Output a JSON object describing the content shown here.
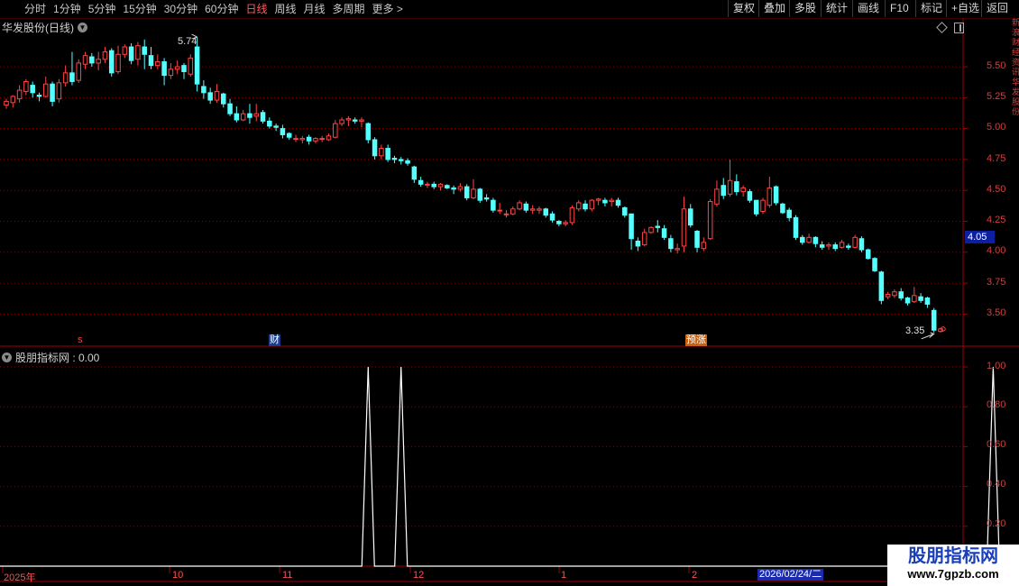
{
  "toolbar": {
    "periods": [
      "分时",
      "1分钟",
      "5分钟",
      "15分钟",
      "30分钟",
      "60分钟",
      "日线",
      "周线",
      "月线",
      "多周期",
      "更多"
    ],
    "active_period": "日线",
    "more_arrow": ">",
    "buttons": [
      "复权",
      "叠加",
      "多股",
      "统计",
      "画线",
      "F10",
      "标记",
      "+自选",
      "返回"
    ]
  },
  "main_chart": {
    "title": "华发股份(日线)",
    "high_label": "5.74",
    "low_label": "3.35",
    "current_price": "4.05",
    "price_axis": [
      "5.50",
      "5.25",
      "5.00",
      "4.75",
      "4.50",
      "4.25",
      "4.00",
      "3.75",
      "3.50"
    ],
    "events": [
      {
        "label": "s",
        "type": "s"
      },
      {
        "label": "财",
        "type": "cai"
      },
      {
        "label": "预涨",
        "type": "yu"
      }
    ],
    "colors": {
      "up": "#ff4444",
      "down": "#54ffff",
      "grid": "#8b0000",
      "border": "#a00000"
    }
  },
  "indicator": {
    "title": "股朋指标网 : 0.00",
    "axis": [
      "1.00",
      "0.80",
      "0.60",
      "0.40",
      "0.20"
    ]
  },
  "date_axis": {
    "labels": [
      "2025年",
      "10",
      "11",
      "12",
      "1",
      "2"
    ],
    "selected_date": "2026/02/24/二"
  },
  "watermark": {
    "line1": "股朋指标网",
    "line2": "www.7gpzb.com"
  },
  "right_strip_text": "新浪财经资讯华发股份",
  "chart_data": {
    "type": "candlestick",
    "ylim": [
      3.3,
      5.85
    ],
    "candles": [
      [
        5.19,
        5.22,
        5.16,
        5.24
      ],
      [
        5.21,
        5.26,
        5.17,
        5.27
      ],
      [
        5.24,
        5.31,
        5.21,
        5.35
      ],
      [
        5.3,
        5.38,
        5.27,
        5.4
      ],
      [
        5.35,
        5.29,
        5.25,
        5.38
      ],
      [
        5.27,
        5.26,
        5.22,
        5.29
      ],
      [
        5.26,
        5.36,
        5.25,
        5.42
      ],
      [
        5.36,
        5.22,
        5.18,
        5.38
      ],
      [
        5.24,
        5.37,
        5.21,
        5.4
      ],
      [
        5.37,
        5.45,
        5.34,
        5.51
      ],
      [
        5.45,
        5.38,
        5.35,
        5.62
      ],
      [
        5.39,
        5.53,
        5.37,
        5.56
      ],
      [
        5.52,
        5.59,
        5.48,
        5.62
      ],
      [
        5.58,
        5.53,
        5.5,
        5.61
      ],
      [
        5.53,
        5.56,
        5.47,
        5.62
      ],
      [
        5.56,
        5.62,
        5.53,
        5.66
      ],
      [
        5.63,
        5.45,
        5.42,
        5.65
      ],
      [
        5.46,
        5.6,
        5.44,
        5.67
      ],
      [
        5.6,
        5.66,
        5.57,
        5.68
      ],
      [
        5.66,
        5.55,
        5.52,
        5.69
      ],
      [
        5.56,
        5.67,
        5.51,
        5.7
      ],
      [
        5.66,
        5.6,
        5.48,
        5.72
      ],
      [
        5.59,
        5.51,
        5.48,
        5.66
      ],
      [
        5.51,
        5.54,
        5.48,
        5.6
      ],
      [
        5.54,
        5.43,
        5.35,
        5.57
      ],
      [
        5.43,
        5.48,
        5.4,
        5.53
      ],
      [
        5.48,
        5.5,
        5.44,
        5.55
      ],
      [
        5.51,
        5.46,
        5.4,
        5.53
      ],
      [
        5.44,
        5.57,
        5.42,
        5.6
      ],
      [
        5.66,
        5.36,
        5.3,
        5.74
      ],
      [
        5.34,
        5.29,
        5.24,
        5.39
      ],
      [
        5.29,
        5.23,
        5.2,
        5.33
      ],
      [
        5.23,
        5.3,
        5.21,
        5.36
      ],
      [
        5.28,
        5.2,
        5.17,
        5.29
      ],
      [
        5.2,
        5.12,
        5.1,
        5.24
      ],
      [
        5.12,
        5.07,
        5.05,
        5.18
      ],
      [
        5.07,
        5.12,
        5.06,
        5.15
      ],
      [
        5.12,
        5.09,
        5.04,
        5.2
      ],
      [
        5.1,
        5.12,
        5.06,
        5.2
      ],
      [
        5.13,
        5.06,
        5.04,
        5.15
      ],
      [
        5.06,
        5.02,
        5.0,
        5.09
      ],
      [
        5.02,
        5.01,
        4.98,
        5.04
      ],
      [
        5.0,
        4.95,
        4.92,
        5.03
      ],
      [
        4.96,
        4.93,
        4.91,
        4.97
      ],
      [
        4.92,
        4.92,
        4.89,
        4.95
      ],
      [
        4.91,
        4.92,
        4.88,
        4.94
      ],
      [
        4.93,
        4.9,
        4.87,
        4.95
      ],
      [
        4.9,
        4.92,
        4.88,
        4.93
      ],
      [
        4.92,
        4.92,
        4.89,
        4.94
      ],
      [
        4.91,
        4.94,
        4.9,
        4.96
      ],
      [
        4.93,
        5.04,
        4.92,
        5.07
      ],
      [
        5.04,
        5.07,
        5.02,
        5.09
      ],
      [
        5.07,
        5.08,
        5.02,
        5.1
      ],
      [
        5.07,
        5.06,
        5.04,
        5.09
      ],
      [
        5.06,
        5.07,
        5.01,
        5.09
      ],
      [
        5.04,
        4.91,
        4.88,
        5.05
      ],
      [
        4.91,
        4.78,
        4.75,
        4.93
      ],
      [
        4.78,
        4.84,
        4.75,
        4.87
      ],
      [
        4.84,
        4.75,
        4.73,
        4.87
      ],
      [
        4.76,
        4.75,
        4.72,
        4.78
      ],
      [
        4.75,
        4.74,
        4.71,
        4.77
      ],
      [
        4.74,
        4.72,
        4.7,
        4.76
      ],
      [
        4.69,
        4.59,
        4.56,
        4.7
      ],
      [
        4.58,
        4.55,
        4.53,
        4.61
      ],
      [
        4.55,
        4.55,
        4.52,
        4.57
      ],
      [
        4.55,
        4.53,
        4.51,
        4.57
      ],
      [
        4.53,
        4.55,
        4.5,
        4.56
      ],
      [
        4.54,
        4.52,
        4.51,
        4.55
      ],
      [
        4.52,
        4.51,
        4.47,
        4.54
      ],
      [
        4.51,
        4.53,
        4.49,
        4.56
      ],
      [
        4.53,
        4.44,
        4.42,
        4.55
      ],
      [
        4.44,
        4.51,
        4.43,
        4.59
      ],
      [
        4.51,
        4.42,
        4.4,
        4.52
      ],
      [
        4.44,
        4.43,
        4.41,
        4.47
      ],
      [
        4.42,
        4.34,
        4.32,
        4.44
      ],
      [
        4.34,
        4.34,
        4.31,
        4.4
      ],
      [
        4.31,
        4.31,
        4.28,
        4.34
      ],
      [
        4.31,
        4.35,
        4.3,
        4.37
      ],
      [
        4.35,
        4.4,
        4.34,
        4.42
      ],
      [
        4.39,
        4.34,
        4.32,
        4.41
      ],
      [
        4.34,
        4.35,
        4.31,
        4.38
      ],
      [
        4.34,
        4.35,
        4.31,
        4.37
      ],
      [
        4.35,
        4.3,
        4.28,
        4.36
      ],
      [
        4.31,
        4.26,
        4.24,
        4.33
      ],
      [
        4.25,
        4.23,
        4.21,
        4.26
      ],
      [
        4.23,
        4.24,
        4.21,
        4.26
      ],
      [
        4.24,
        4.36,
        4.22,
        4.38
      ],
      [
        4.35,
        4.4,
        4.33,
        4.42
      ],
      [
        4.39,
        4.35,
        4.33,
        4.42
      ],
      [
        4.35,
        4.42,
        4.33,
        4.43
      ],
      [
        4.42,
        4.43,
        4.38,
        4.44
      ],
      [
        4.42,
        4.4,
        4.37,
        4.44
      ],
      [
        4.41,
        4.42,
        4.37,
        4.44
      ],
      [
        4.42,
        4.38,
        4.36,
        4.44
      ],
      [
        4.36,
        4.3,
        4.28,
        4.37
      ],
      [
        4.31,
        4.11,
        4.02,
        4.31
      ],
      [
        4.09,
        4.05,
        4.01,
        4.12
      ],
      [
        4.06,
        4.16,
        4.05,
        4.19
      ],
      [
        4.16,
        4.2,
        4.15,
        4.21
      ],
      [
        4.21,
        4.2,
        4.16,
        4.26
      ],
      [
        4.19,
        4.12,
        4.1,
        4.22
      ],
      [
        4.11,
        4.03,
        4.0,
        4.14
      ],
      [
        4.02,
        4.03,
        3.99,
        4.07
      ],
      [
        4.05,
        4.35,
        4.0,
        4.45
      ],
      [
        4.35,
        4.22,
        4.2,
        4.39
      ],
      [
        4.17,
        4.04,
        4.0,
        4.18
      ],
      [
        4.03,
        4.08,
        4.01,
        4.12
      ],
      [
        4.11,
        4.41,
        4.1,
        4.43
      ],
      [
        4.39,
        4.51,
        4.37,
        4.58
      ],
      [
        4.54,
        4.46,
        4.43,
        4.6
      ],
      [
        4.47,
        4.58,
        4.45,
        4.75
      ],
      [
        4.57,
        4.49,
        4.46,
        4.63
      ],
      [
        4.49,
        4.52,
        4.45,
        4.54
      ],
      [
        4.49,
        4.42,
        4.4,
        4.51
      ],
      [
        4.42,
        4.31,
        4.29,
        4.42
      ],
      [
        4.33,
        4.42,
        4.31,
        4.44
      ],
      [
        4.38,
        4.52,
        4.36,
        4.61
      ],
      [
        4.53,
        4.4,
        4.38,
        4.54
      ],
      [
        4.39,
        4.32,
        4.31,
        4.4
      ],
      [
        4.34,
        4.28,
        4.25,
        4.36
      ],
      [
        4.28,
        4.12,
        4.1,
        4.3
      ],
      [
        4.12,
        4.08,
        4.06,
        4.14
      ],
      [
        4.08,
        4.12,
        4.07,
        4.15
      ],
      [
        4.12,
        4.07,
        4.04,
        4.13
      ],
      [
        4.06,
        4.04,
        4.02,
        4.09
      ],
      [
        4.05,
        4.06,
        4.02,
        4.08
      ],
      [
        4.06,
        4.03,
        4.01,
        4.08
      ],
      [
        4.04,
        4.08,
        4.03,
        4.1
      ],
      [
        4.05,
        4.04,
        4.02,
        4.07
      ],
      [
        4.04,
        4.12,
        4.03,
        4.14
      ],
      [
        4.11,
        4.02,
        4.0,
        4.13
      ],
      [
        4.02,
        3.95,
        3.94,
        4.03
      ],
      [
        3.95,
        3.85,
        3.84,
        3.96
      ],
      [
        3.84,
        3.61,
        3.58,
        3.85
      ],
      [
        3.64,
        3.66,
        3.62,
        3.68
      ],
      [
        3.65,
        3.68,
        3.63,
        3.7
      ],
      [
        3.68,
        3.63,
        3.61,
        3.71
      ],
      [
        3.63,
        3.59,
        3.57,
        3.64
      ],
      [
        3.6,
        3.65,
        3.59,
        3.72
      ],
      [
        3.64,
        3.61,
        3.59,
        3.67
      ],
      [
        3.63,
        3.58,
        3.55,
        3.64
      ],
      [
        3.53,
        3.37,
        3.35,
        3.55
      ],
      [
        3.36,
        3.38,
        3.35,
        3.39
      ]
    ],
    "indicator_series": {
      "name": "股朋指标网",
      "spikes_at_candle_index": [
        55,
        60,
        150
      ],
      "spike_value": 1.0,
      "baseline": 0.0
    }
  }
}
